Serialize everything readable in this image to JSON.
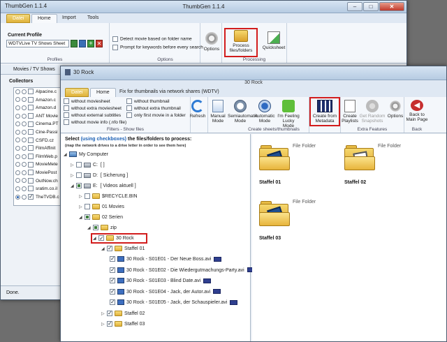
{
  "back_window": {
    "app_label": "ThumbGen 1.1.4",
    "title": "ThumbGen 1.1.4",
    "tabs": [
      "Datei",
      "Home",
      "Import",
      "Tools"
    ],
    "current_profile_label": "Current Profile",
    "profile_value": "WDTVLive TV Shows Sheet",
    "options": [
      "Detect movie based on folder name",
      "Prompt for keywords before every search"
    ],
    "buttons": {
      "options": "Options",
      "process": "Process files/folders",
      "quicksheet": "Quicksheet"
    },
    "groups": {
      "profiles": "Profiles",
      "options": "Options",
      "processing": "Processing"
    },
    "nav_tab": "Movies / TV Shows",
    "collectors_label": "Collectors",
    "collectors": [
      "Alpacine.c",
      "Amazon.c",
      "Amazon.d",
      "ANT Movie",
      "Cinema.PT",
      "Cine-Passi",
      "CSFD.cz",
      "FilmAffinit",
      "FilmWeb.p",
      "MovieMete",
      "MoviePost",
      "OutNow.ch",
      "sratim.co.il",
      "TheTVDB.c"
    ],
    "status": "Done."
  },
  "front_window": {
    "title": "30 Rock",
    "tabs": [
      "Datei",
      "Home"
    ],
    "wdtv_tab": "Fix for thumbnails via network shares (WDTV)",
    "filters_col1": [
      "without moviesheet",
      "without extra moviesheet",
      "without external subtitles",
      "without movie info (.nfo file)"
    ],
    "filters_col2": [
      "without thumbnail",
      "without extra thumbnail",
      "only first movie in a folder"
    ],
    "buttons": {
      "refresh": "Refresh",
      "manual": "Manual Mode",
      "semiautomatic": "Semiautomatic Mode",
      "automatic": "Automatic Mode",
      "lucky": "I'm Feeling Lucky Mode",
      "create_metadata": "Create from Metadata",
      "create_playlists": "Create Playlists",
      "random_snapshots": "Get Random Snapshots",
      "options": "Options",
      "back": "Back to Main Page"
    },
    "groups": {
      "filters": "Filters - Show files",
      "create": "Create sheets/thumbnails",
      "extra": "Extra Features",
      "back": "Back"
    },
    "select_prefix": "Select ",
    "select_link": "(using checkboxes)",
    "select_suffix": " the files/folders to process:",
    "select_note": "(map the network drives to a drive letter in order to see them here)",
    "tree": {
      "root": "My Computer",
      "c_drive": "C:",
      "c_label": "[ ]",
      "d_drive": "D:",
      "d_label": "[ Sicherung ]",
      "e_drive": "E:",
      "e_label": "[ Videos aktuell ]",
      "recycle": "$RECYCLE.BIN",
      "movies": "01 Movies",
      "serien": "02 Serien",
      "zip": "zip",
      "show": "30 Rock",
      "staffel01": "Staffel 01",
      "episodes": [
        "30 Rock - S01E01 - Der Neue Boss.avi",
        "30 Rock - S01E02 - Die Wiedergutmachungs-Party.avi",
        "30 Rock - S01E03 - Blind Date.avi",
        "30 Rock - S01E04 - Jack, der Autor.avi",
        "30 Rock - S01E05 - Jack, der Schauspieler.avi"
      ],
      "staffel02": "Staffel 02",
      "staffel03": "Staffel 03"
    },
    "folders": [
      {
        "type": "File Folder",
        "name": "Staffel 01"
      },
      {
        "type": "File Folder",
        "name": "Staffel 02"
      },
      {
        "type": "File Folder",
        "name": "Staffel 03"
      }
    ]
  },
  "colors": {
    "highlight": "#d21c1c",
    "file_tab": "#e0b23a",
    "link": "#1a5fb4"
  }
}
